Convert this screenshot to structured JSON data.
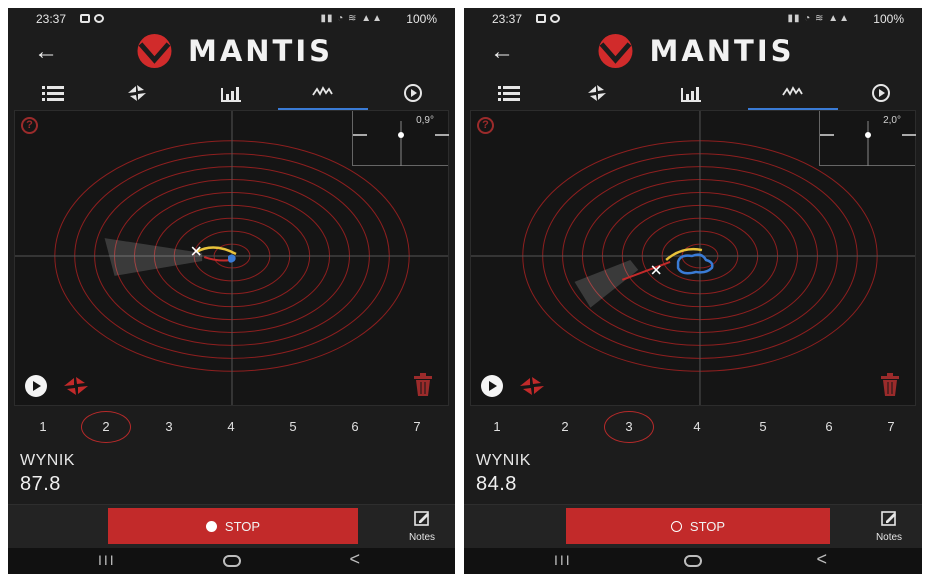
{
  "accent_color": "#c22a2a",
  "tab_active_color": "#3a7bd5",
  "app": {
    "brand": "MANTIS"
  },
  "icons": {
    "back": "back-arrow-icon",
    "tabs": [
      "list-icon",
      "aim-icon",
      "bar-chart-icon",
      "trace-icon",
      "play-circle-icon"
    ],
    "help": "help-icon",
    "replay": "play-icon",
    "aim": "aim-icon",
    "delete": "trash-icon",
    "notes": "notes-icon"
  },
  "screens": [
    {
      "status": {
        "time": "23:37",
        "battery": "100%"
      },
      "level": "0,9°",
      "shots": [
        "1",
        "2",
        "3",
        "4",
        "5",
        "6",
        "7"
      ],
      "selected_shot": 2,
      "result": {
        "label": "WYNIK",
        "value": "87.8"
      },
      "stop_label": "STOP",
      "notes_label": "Notes"
    },
    {
      "status": {
        "time": "23:37",
        "battery": "100%"
      },
      "level": "2,0°",
      "shots": [
        "1",
        "2",
        "3",
        "4",
        "5",
        "6",
        "7"
      ],
      "selected_shot": 3,
      "result": {
        "label": "WYNIK",
        "value": "84.8"
      },
      "stop_label": "STOP",
      "notes_label": "Notes"
    }
  ],
  "nav": {
    "recents": "III",
    "back": "<"
  }
}
